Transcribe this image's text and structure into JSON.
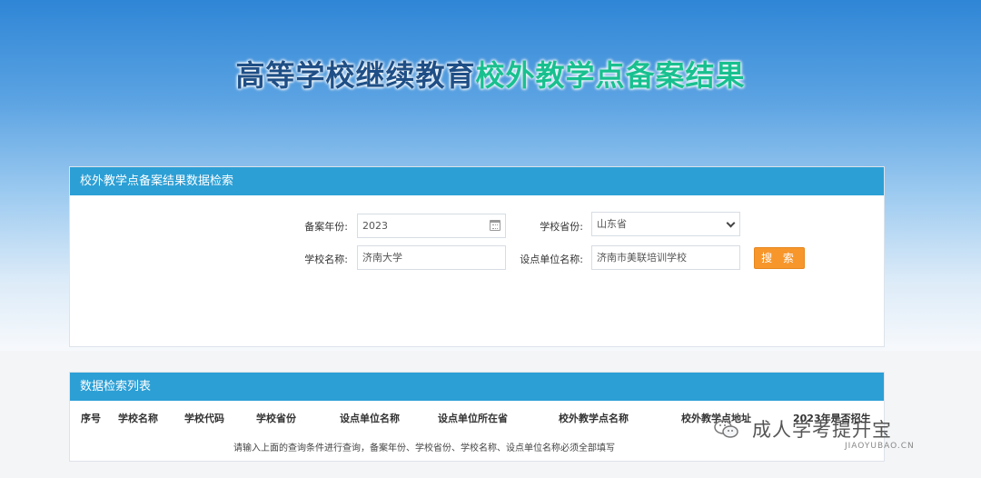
{
  "header": {
    "title_part1": "高等学校继续教育",
    "title_part2": "校外教学点备案结果",
    "title_color1": "#1f4f86",
    "title_color2": "#19c08f"
  },
  "search_panel": {
    "title": "校外教学点备案结果数据检索",
    "year_label": "备案年份:",
    "year_value": "2023",
    "province_label": "学校省份:",
    "province_value": "山东省",
    "school_label": "学校名称:",
    "school_value": "济南大学",
    "unit_label": "设点单位名称:",
    "unit_value": "济南市美联培训学校",
    "search_button": "搜 索"
  },
  "result_panel": {
    "title": "数据检索列表",
    "columns": [
      "序号",
      "学校名称",
      "学校代码",
      "学校省份",
      "设点单位名称",
      "设点单位所在省",
      "校外教学点名称",
      "校外教学点地址",
      "2023年是否招生"
    ],
    "empty_message": "请输入上面的查询条件进行查询，备案年份、学校省份、学校名称、设点单位名称必须全部填写"
  },
  "watermark": {
    "text": "成人学考提升宝",
    "sub": "JIAOYUBAO.CN"
  },
  "colors": {
    "panel_header": "#2c9fd5",
    "search_button": "#f7962b"
  }
}
